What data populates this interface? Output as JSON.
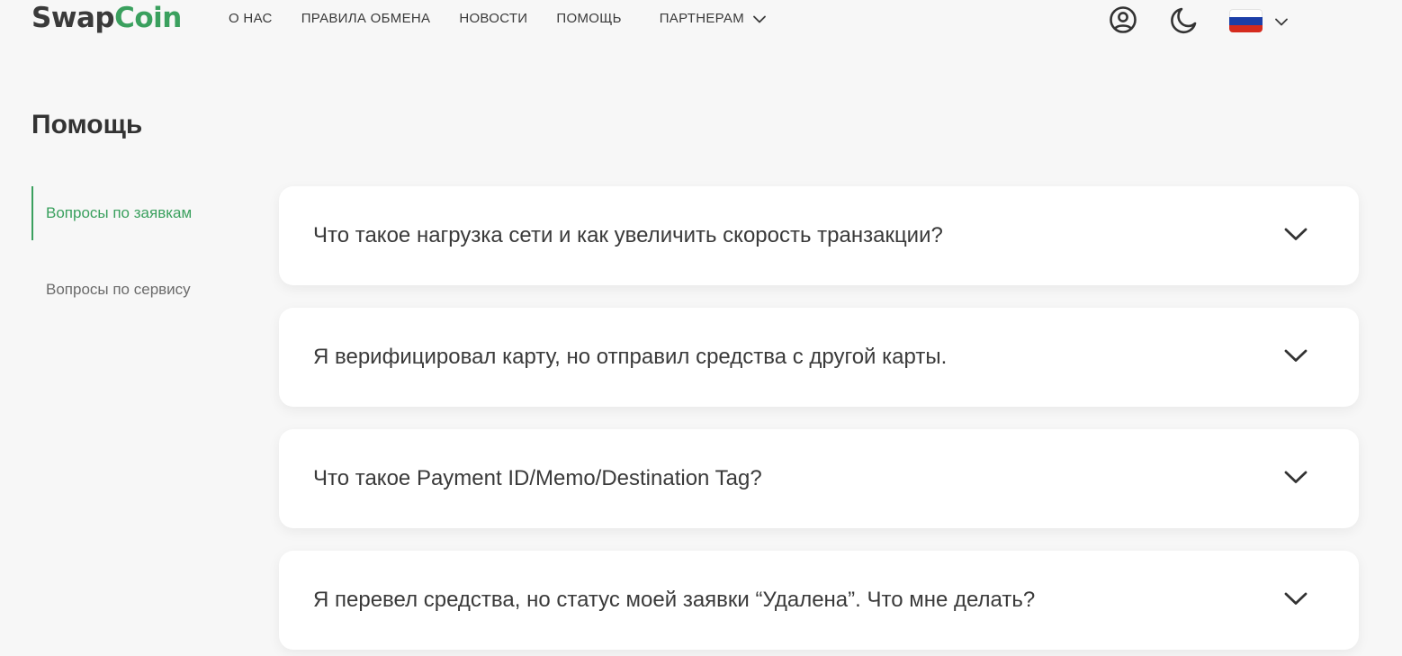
{
  "header": {
    "logo_part1": "Swap",
    "logo_part2": "Coin",
    "nav": [
      {
        "label": "О НАС"
      },
      {
        "label": "ПРАВИЛА ОБМЕНА"
      },
      {
        "label": "НОВОСТИ"
      },
      {
        "label": "ПОМОЩЬ"
      },
      {
        "label": "ПАРТНЕРАМ"
      }
    ],
    "icons": {
      "user": "user-circle-icon",
      "theme": "moon-icon",
      "language": "russia-flag-icon"
    }
  },
  "page": {
    "title": "Помощь"
  },
  "sidebar": {
    "items": [
      {
        "label": "Вопросы по заявкам",
        "active": true
      },
      {
        "label": "Вопросы по сервису",
        "active": false
      }
    ]
  },
  "faq": [
    {
      "question": "Что такое нагрузка сети и как увеличить скорость транзакции?"
    },
    {
      "question": "Я верифицировал карту, но отправил средства с другой карты."
    },
    {
      "question": "Что такое Payment ID/Memo/Destination Tag?"
    },
    {
      "question": "Я перевел средства, но статус моей заявки “Удалена”. Что мне делать?"
    }
  ],
  "colors": {
    "accent": "#3aa05e",
    "text": "#333333",
    "muted": "#6b6b6b",
    "background": "#f7f7f7",
    "card": "#ffffff",
    "flag_white": "#ffffff",
    "flag_blue": "#1c3fa8",
    "flag_red": "#d52b1e"
  }
}
